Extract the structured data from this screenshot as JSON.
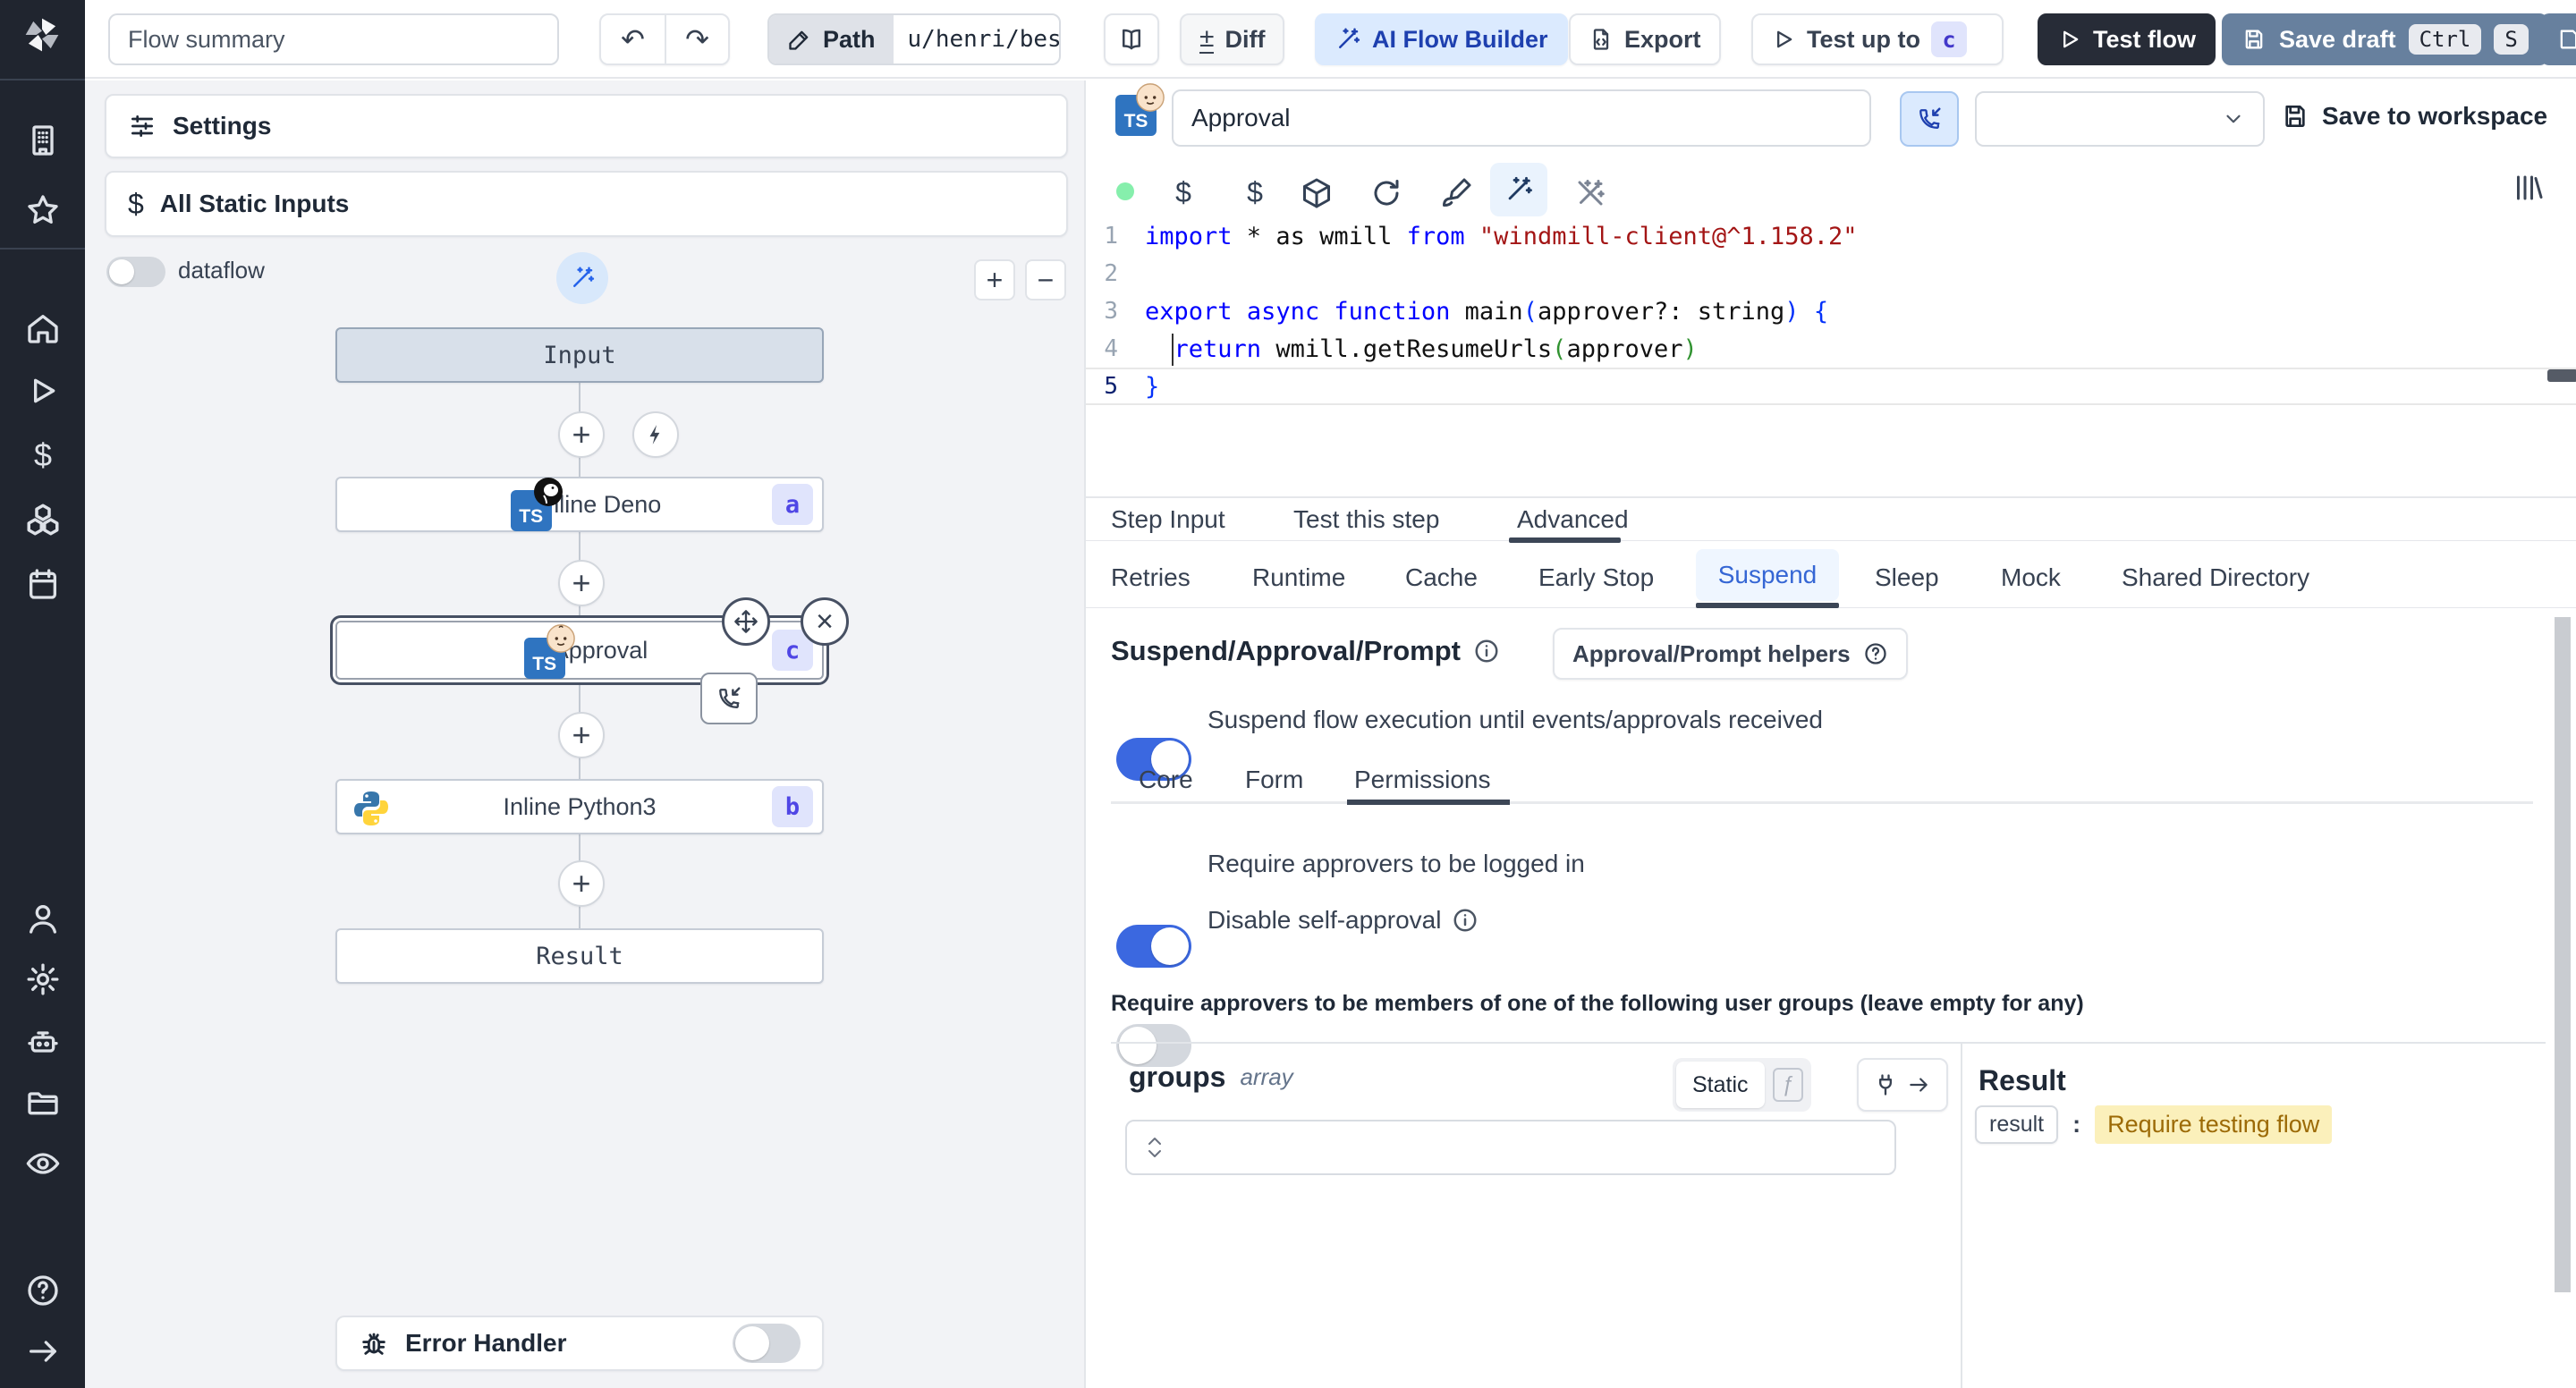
{
  "colors": {
    "accent_blue": "#3b68e0",
    "ai_button_bg": "#dbeafe",
    "ai_button_text": "#1e40af",
    "save_draft_bg": "#67809e",
    "test_flow_bg": "#272c37",
    "node_badge_bg": "#e0e4fc",
    "node_badge_text": "#4f46e5",
    "result_highlight_bg": "#fbf0bb",
    "result_highlight_text": "#9c6a06",
    "suspend_tab_text": "#3566d4",
    "status_dot_green": "#86efac"
  },
  "topbar": {
    "flow_summary_value": "Flow summary",
    "path_label": "Path",
    "path_value": "u/henri/bes",
    "diff_label": "Diff",
    "ai_flow_builder_label": "AI Flow Builder",
    "export_label": "Export",
    "test_up_to_label": "Test up to",
    "test_up_to_badge": "c",
    "test_flow_label": "Test flow",
    "save_draft_label": "Save draft",
    "kbd": [
      "Ctrl",
      "S"
    ]
  },
  "flow_panel": {
    "settings_label": "Settings",
    "all_static_inputs_label": "All Static Inputs",
    "dataflow_label": "dataflow",
    "zoom_in": "+",
    "zoom_out": "−",
    "nodes": {
      "input_label": "Input",
      "deno": {
        "label": "Inline Deno",
        "badge": "a",
        "lang": "TS"
      },
      "approval": {
        "label": "Approval",
        "badge": "c",
        "lang": "TS"
      },
      "python": {
        "label": "Inline Python3",
        "badge": "b"
      },
      "result_label": "Result"
    },
    "error_handler_label": "Error Handler"
  },
  "editor": {
    "lang": "TS",
    "title_value": "Approval",
    "save_to_workspace_label": "Save to workspace",
    "tabs": [
      {
        "label": "Step Input"
      },
      {
        "label": "Test this step"
      },
      {
        "label": "Advanced",
        "active": true
      }
    ],
    "code": {
      "active_line": 5,
      "lines": [
        {
          "n": "1",
          "tokens": [
            {
              "t": "import",
              "c": "kw"
            },
            {
              "t": " * as wmill ",
              "c": "pl"
            },
            {
              "t": "from",
              "c": "kw"
            },
            {
              "t": " ",
              "c": "pl"
            },
            {
              "t": "\"windmill-client@^1.158.2\"",
              "c": "str"
            }
          ]
        },
        {
          "n": "2",
          "tokens": []
        },
        {
          "n": "3",
          "tokens": [
            {
              "t": "export",
              "c": "kw"
            },
            {
              "t": " ",
              "c": "pl"
            },
            {
              "t": "async",
              "c": "kw"
            },
            {
              "t": " ",
              "c": "pl"
            },
            {
              "t": "function",
              "c": "kw"
            },
            {
              "t": " main",
              "c": "pl"
            },
            {
              "t": "(",
              "c": "brb"
            },
            {
              "t": "approver?: string",
              "c": "pl"
            },
            {
              "t": ")",
              "c": "brb"
            },
            {
              "t": " ",
              "c": "pl"
            },
            {
              "t": "{",
              "c": "brb"
            }
          ]
        },
        {
          "n": "4",
          "tokens": [
            {
              "t": "  ",
              "c": "pl"
            },
            {
              "t": "return",
              "c": "kw"
            },
            {
              "t": " wmill.getResumeUrls",
              "c": "pl"
            },
            {
              "t": "(",
              "c": "brg"
            },
            {
              "t": "approver",
              "c": "pl"
            },
            {
              "t": ")",
              "c": "brg"
            }
          ]
        },
        {
          "n": "5",
          "tokens": [
            {
              "t": "}",
              "c": "brb"
            }
          ]
        }
      ]
    }
  },
  "advanced": {
    "subtabs": [
      {
        "label": "Retries"
      },
      {
        "label": "Runtime"
      },
      {
        "label": "Cache"
      },
      {
        "label": "Early Stop"
      },
      {
        "label": "Suspend",
        "active": true
      },
      {
        "label": "Sleep"
      },
      {
        "label": "Mock"
      },
      {
        "label": "Shared Directory"
      }
    ],
    "suspend": {
      "title": "Suspend/Approval/Prompt",
      "helpers_button_label": "Approval/Prompt helpers",
      "suspend_toggle_label": "Suspend flow execution until events/approvals received",
      "suspend_toggle_on": true,
      "inner_tabs": [
        {
          "label": "Core"
        },
        {
          "label": "Form"
        },
        {
          "label": "Permissions",
          "active": true
        }
      ],
      "require_login_label": "Require approvers to be logged in",
      "require_login_on": true,
      "disable_self_approval_label": "Disable self-approval",
      "disable_self_approval_on": false,
      "groups_heading": "Require approvers to be members of one of the following user groups (leave empty for any)",
      "groups_field": {
        "name": "groups",
        "type": "array",
        "mode_static_label": "Static",
        "fn_glyph": "ƒ"
      },
      "result_panel": {
        "heading": "Result",
        "key": "result",
        "value": "Require testing flow"
      }
    }
  }
}
